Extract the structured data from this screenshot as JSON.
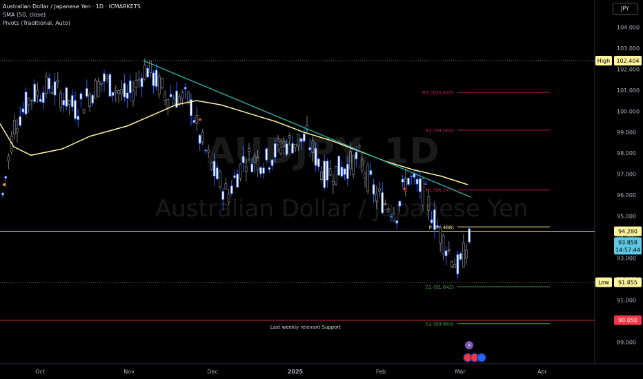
{
  "legend": {
    "title": "Australian Dollar / Japanese Yen · 1D · ICMARKETS",
    "sma": "SMA (50, close)",
    "pivots": "Pivots (Traditional, Auto)"
  },
  "currency_button": "JPY",
  "watermark": {
    "symbol": "AUDJPY, 1D",
    "name": "Australian Dollar / Japanese Yen"
  },
  "colors": {
    "up": "#2962ff",
    "up_fill": "#ffffff",
    "down": "#787b86",
    "sma": "#fff59d",
    "trend": "#26a69a",
    "pivot_r": "#c2185b",
    "pivot_p": "#fff59d",
    "pivot_s": "#43a047",
    "support": "#f23645"
  },
  "chart_data": {
    "type": "candlestick",
    "title": "Australian Dollar / Japanese Yen · 1D · ICMARKETS",
    "y_ticks": [
      "104.000",
      "103.000",
      "102.000",
      "101.000",
      "100.000",
      "99.000",
      "98.000",
      "97.000",
      "96.000",
      "95.000",
      "94.000",
      "93.000",
      "92.000",
      "91.000",
      "90.000",
      "89.000"
    ],
    "ylim": [
      88.2,
      104.7
    ],
    "x_ticks": [
      "Oct",
      "Nov",
      "Dec",
      "2025",
      "Feb",
      "Mar",
      "Apr"
    ],
    "candles": [],
    "sma_series": {
      "name": "SMA (50, close)",
      "points": [
        [
          0,
          99.4
        ],
        [
          20,
          98.3
        ],
        [
          45,
          97.9
        ],
        [
          90,
          98.2
        ],
        [
          130,
          98.8
        ],
        [
          185,
          99.3
        ],
        [
          220,
          99.8
        ],
        [
          255,
          100.3
        ],
        [
          285,
          100.5
        ],
        [
          320,
          100.3
        ],
        [
          360,
          99.9
        ],
        [
          400,
          99.5
        ],
        [
          440,
          99.0
        ],
        [
          480,
          98.6
        ],
        [
          520,
          98.1
        ],
        [
          560,
          97.6
        ],
        [
          600,
          97.2
        ],
        [
          640,
          96.9
        ],
        [
          678,
          96.5
        ]
      ]
    },
    "trendline": {
      "from": [
        208,
        102.4
      ],
      "to": [
        683,
        95.9
      ]
    },
    "pivots": [
      {
        "label": "R3 (100.892)",
        "value": 100.892
      },
      {
        "label": "R2 (99.093)",
        "value": 99.093
      },
      {
        "label": "R1 (96.247)",
        "value": 96.247
      },
      {
        "label": "P (94.488)",
        "value": 94.488
      },
      {
        "label": "S1 (91.642)",
        "value": 91.642
      },
      {
        "label": "S2 (89.883)",
        "value": 89.883
      }
    ],
    "levels": [
      {
        "label": "High",
        "value": "102.404"
      },
      {
        "label": "Low",
        "value": "91.855"
      },
      {
        "value": "94.280"
      },
      {
        "value": "90.050"
      }
    ],
    "support_annotation": "Last weekly relevant Support",
    "last_price": {
      "value": "93.858",
      "countdown": "14:57:44"
    }
  }
}
